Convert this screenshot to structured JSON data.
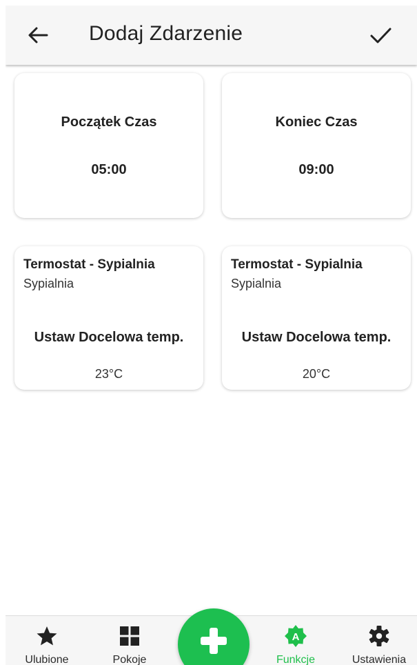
{
  "header": {
    "title": "Dodaj Zdarzenie",
    "back_icon": "arrow-left-icon",
    "confirm_icon": "check-icon"
  },
  "times": {
    "start": {
      "label": "Początek Czas",
      "value": "05:00"
    },
    "end": {
      "label": "Koniec Czas",
      "value": "09:00"
    }
  },
  "devices": [
    {
      "name": "Termostat - Sypialnia",
      "room": "Sypialnia",
      "action": "Ustaw Docelowa temp.",
      "value": "23°C"
    },
    {
      "name": "Termostat - Sypialnia",
      "room": "Sypialnia",
      "action": "Ustaw Docelowa temp.",
      "value": "20°C"
    }
  ],
  "nav": {
    "items": [
      {
        "label": "Ulubione",
        "icon": "star-icon"
      },
      {
        "label": "Pokoje",
        "icon": "grid-icon"
      },
      {
        "label": "Funkcje",
        "icon": "automation-icon",
        "active": true
      },
      {
        "label": "Ustawienia",
        "icon": "gear-icon"
      }
    ],
    "fab_icon": "plus-icon"
  },
  "colors": {
    "accent": "#1dbf50",
    "active_label": "#1fbf4b",
    "appbar": "#f6f6f6"
  }
}
